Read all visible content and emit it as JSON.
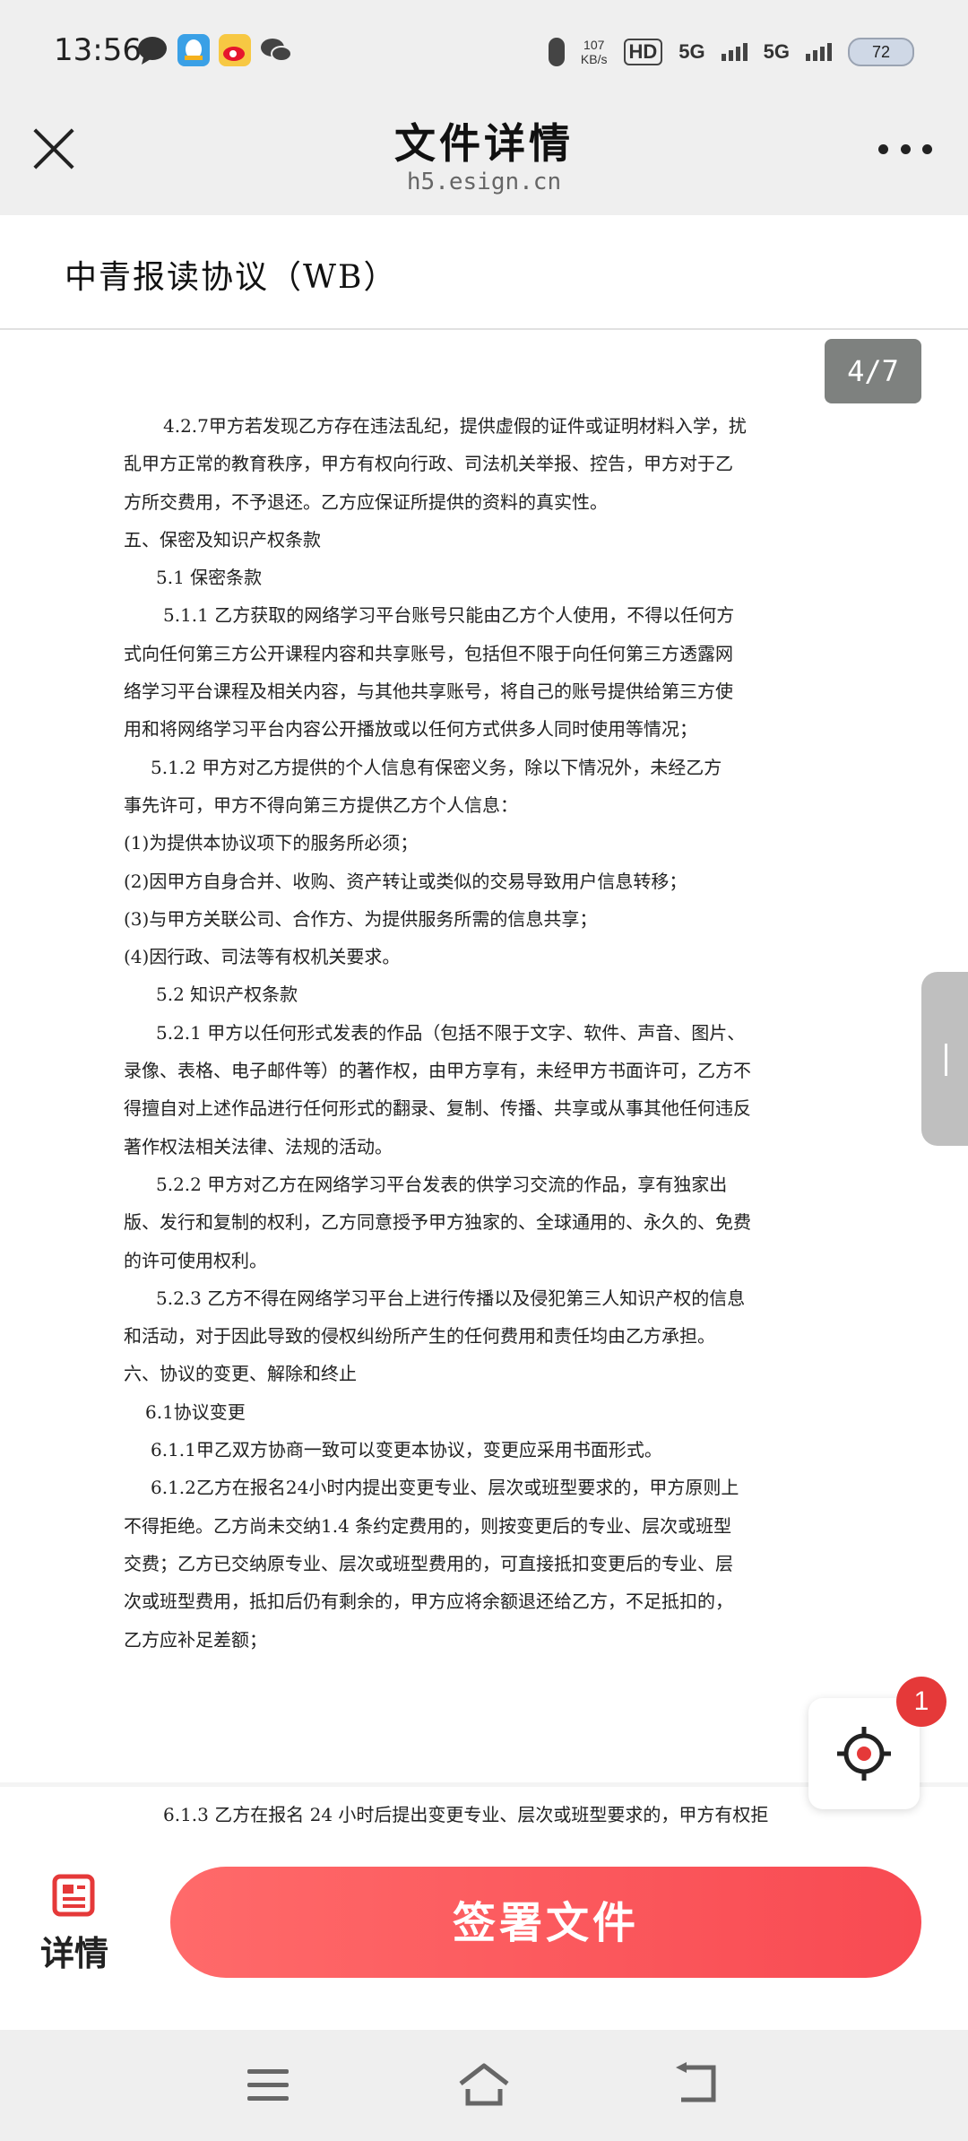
{
  "status_bar": {
    "time": "13:56",
    "net_speed_value": "107",
    "net_speed_unit": "KB/s",
    "hd_label": "HD",
    "sim1_label": "5G",
    "sim2_label": "5G",
    "battery": "72",
    "icons": [
      "chat-bubble-icon",
      "qq-icon",
      "weibo-icon",
      "wechat-icon",
      "microphone-icon",
      "hd-icon",
      "signal-icon",
      "battery-icon"
    ]
  },
  "header": {
    "title": "文件详情",
    "subtitle": "h5.esign.cn"
  },
  "document": {
    "name": "中青报读协议（WB）",
    "page_indicator": "4/7",
    "lines": [
      {
        "indent": "i1",
        "text": "4.2.7甲方若发现乙方存在违法乱纪，提供虚假的证件或证明材料入学，扰"
      },
      {
        "indent": "",
        "text": "乱甲方正常的教育秩序，甲方有权向行政、司法机关举报、控告，甲方对于乙"
      },
      {
        "indent": "",
        "text": "方所交费用，不予退还。乙方应保证所提供的资料的真实性。"
      },
      {
        "indent": "",
        "text": "五、保密及知识产权条款"
      },
      {
        "indent": "i3",
        "text": "5.1 保密条款"
      },
      {
        "indent": "i1",
        "text": "5.1.1 乙方获取的网络学习平台账号只能由乙方个人使用，不得以任何方"
      },
      {
        "indent": "",
        "text": "式向任何第三方公开课程内容和共享账号，包括但不限于向任何第三方透露网"
      },
      {
        "indent": "",
        "text": "络学习平台课程及相关内容，与其他共享账号，将自己的账号提供给第三方使"
      },
      {
        "indent": "",
        "text": "用和将网络学习平台内容公开播放或以任何方式供多人同时使用等情况；"
      },
      {
        "indent": "i2",
        "text": "5.1.2 甲方对乙方提供的个人信息有保密义务，除以下情况外，未经乙方"
      },
      {
        "indent": "",
        "text": "事先许可，甲方不得向第三方提供乙方个人信息："
      },
      {
        "indent": "",
        "text": "(1)为提供本协议项下的服务所必须；"
      },
      {
        "indent": "",
        "text": "(2)因甲方自身合并、收购、资产转让或类似的交易导致用户信息转移；"
      },
      {
        "indent": "",
        "text": "(3)与甲方关联公司、合作方、为提供服务所需的信息共享；"
      },
      {
        "indent": "",
        "text": "(4)因行政、司法等有权机关要求。"
      },
      {
        "indent": "i3",
        "text": "5.2 知识产权条款"
      },
      {
        "indent": "i3",
        "text": "5.2.1 甲方以任何形式发表的作品（包括不限于文字、软件、声音、图片、"
      },
      {
        "indent": "",
        "text": "录像、表格、电子邮件等）的著作权，由甲方享有，未经甲方书面许可，乙方不"
      },
      {
        "indent": "",
        "text": "得擅自对上述作品进行任何形式的翻录、复制、传播、共享或从事其他任何违反"
      },
      {
        "indent": "",
        "text": "著作权法相关法律、法规的活动。"
      },
      {
        "indent": "i3",
        "text": "5.2.2 甲方对乙方在网络学习平台发表的供学习交流的作品，享有独家出"
      },
      {
        "indent": "",
        "text": "版、发行和复制的权利，乙方同意授予甲方独家的、全球通用的、永久的、免费"
      },
      {
        "indent": "",
        "text": "的许可使用权利。"
      },
      {
        "indent": "i3",
        "text": "5.2.3 乙方不得在网络学习平台上进行传播以及侵犯第三人知识产权的信息"
      },
      {
        "indent": "",
        "text": "和活动，对于因此导致的侵权纠纷所产生的任何费用和责任均由乙方承担。"
      },
      {
        "indent": "",
        "text": "六、协议的变更、解除和终止"
      },
      {
        "indent": "i4",
        "text": "6.1协议变更"
      },
      {
        "indent": "i2",
        "text": "6.1.1甲乙双方协商一致可以变更本协议，变更应采用书面形式。"
      },
      {
        "indent": "i2",
        "text": "6.1.2乙方在报名24小时内提出变更专业、层次或班型要求的，甲方原则上"
      },
      {
        "indent": "",
        "text": "不得拒绝。乙方尚未交纳1.4 条约定费用的，则按变更后的专业、层次或班型"
      },
      {
        "indent": "",
        "text": "交费；乙方已交纳原专业、层次或班型费用的，可直接抵扣变更后的专业、层"
      },
      {
        "indent": "",
        "text": "次或班型费用，抵扣后仍有剩余的，甲方应将余额退还给乙方，不足抵扣的，"
      },
      {
        "indent": "",
        "text": "乙方应补足差额；"
      }
    ],
    "next_page_line": "6.1.3 乙方在报名 24 小时后提出变更专业、层次或班型要求的，甲方有权拒"
  },
  "notification_badge": "1",
  "action_bar": {
    "detail_label": "详情",
    "sign_label": "签署文件"
  },
  "nav_bar": {
    "icons": [
      "menu-icon",
      "home-icon",
      "back-icon"
    ]
  },
  "colors": {
    "sign_button": "#f84a52",
    "accent_red": "#e53939",
    "page_indicator_bg": "#7e817f"
  }
}
